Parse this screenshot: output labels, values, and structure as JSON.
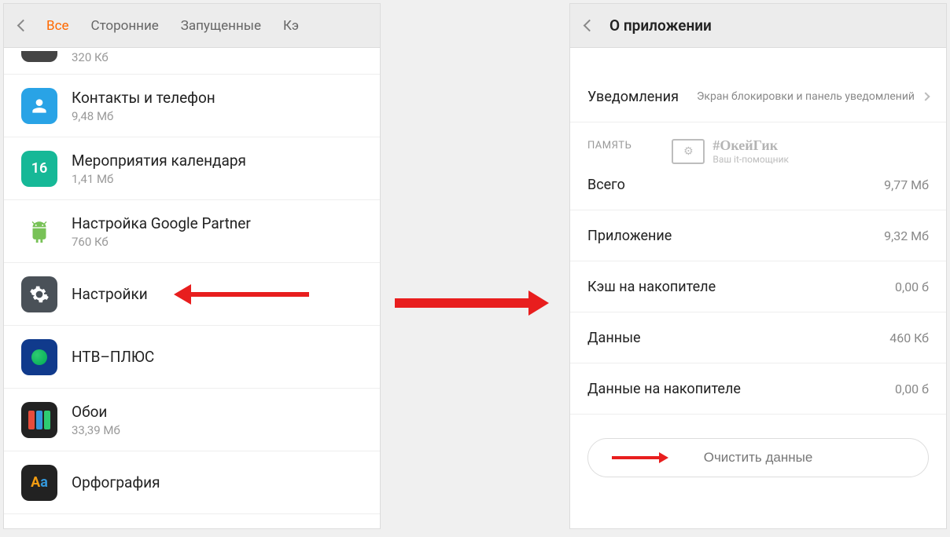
{
  "left": {
    "tabs": {
      "all": "Все",
      "thirdparty": "Сторонние",
      "running": "Запущенные",
      "cache": "Кэ"
    },
    "partialSize": "320 Кб",
    "items": [
      {
        "id": "contacts",
        "name": "Контакты и телефон",
        "size": "9,48 Мб",
        "iconText": ""
      },
      {
        "id": "calendar",
        "name": "Мероприятия календаря",
        "size": "1,41 Мб",
        "iconText": "16"
      },
      {
        "id": "gpartner",
        "name": "Настройка Google Partner",
        "size": "760 Кб",
        "iconText": ""
      },
      {
        "id": "settings",
        "name": "Настройки",
        "size": "",
        "iconText": ""
      },
      {
        "id": "ntv",
        "name": "НТВ–ПЛЮС",
        "size": "",
        "iconText": ""
      },
      {
        "id": "wallpapers",
        "name": "Обои",
        "size": "33,39 Мб",
        "iconText": ""
      },
      {
        "id": "spellcheck",
        "name": "Орфография",
        "size": "",
        "iconText": "Aa"
      }
    ]
  },
  "right": {
    "title": "О приложении",
    "notifications": {
      "label": "Уведомления",
      "value": "Экран блокировки и панель уведомлений"
    },
    "memoryHeader": "ПАМЯТЬ",
    "total": {
      "label": "Всего",
      "value": "9,77 Мб"
    },
    "app": {
      "label": "Приложение",
      "value": "9,32 Мб"
    },
    "cacheStorage": {
      "label": "Кэш на накопителе",
      "value": "0,00 б"
    },
    "data": {
      "label": "Данные",
      "value": "460 Кб"
    },
    "dataStorage": {
      "label": "Данные на накопителе",
      "value": "0,00 б"
    },
    "clearBtn": "Очистить данные"
  },
  "watermark": {
    "title": "#ОкейГик",
    "subtitle": "Ваш it-помощник"
  }
}
